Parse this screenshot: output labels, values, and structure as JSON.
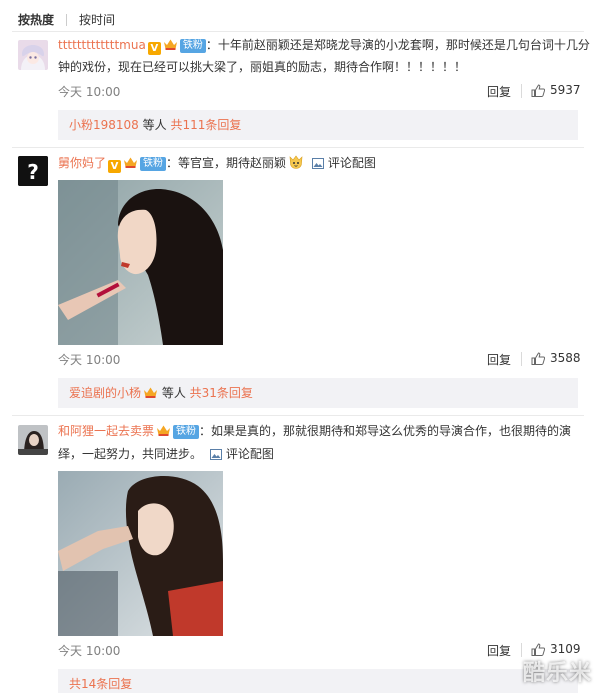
{
  "sort": {
    "hot": "按热度",
    "time": "按时间"
  },
  "comments": [
    {
      "username": "tttttttttttttmua",
      "colon": "：",
      "fan_badge": "铁粉",
      "text_line1": "十年前赵丽颖还是郑晓龙导演的小龙套啊，那时候还是几句台词十几分",
      "text_line2": "钟的戏份，现在已经可以挑大梁了，丽姐真的励志，期待合作啊！！！！！！",
      "time": "今天 10:00",
      "reply": "回复",
      "likes": "5937",
      "replies_user": "小粉198108",
      "replies_mid": " 等人 ",
      "replies_count": "共111条回复"
    },
    {
      "username": "舅你妈了",
      "colon": "：",
      "fan_badge": "铁粉",
      "text": "等官宣，期待赵丽颖",
      "pic_label": "评论配图",
      "time": "今天 10:00",
      "reply": "回复",
      "likes": "3588",
      "replies_user": "爱追剧的小杨",
      "replies_mid": " 等人 ",
      "replies_count": "共31条回复"
    },
    {
      "username": "和阿狸一起去卖票",
      "colon": "：",
      "fan_badge": "铁粉",
      "text_line1": "如果是真的，那就很期待和郑导这么优秀的导演合作，也很期待的演",
      "text_line2": "绎，一起努力，共同进步。",
      "pic_label": "评论配图",
      "time": "今天 10:00",
      "reply": "回复",
      "likes": "3109",
      "replies_count": "共14条回复"
    }
  ],
  "watermark": "酷乐米",
  "colors": {
    "link": "#eb7350",
    "fan_badge": "#56a5e3",
    "reply_box": "#f2f2f5"
  }
}
